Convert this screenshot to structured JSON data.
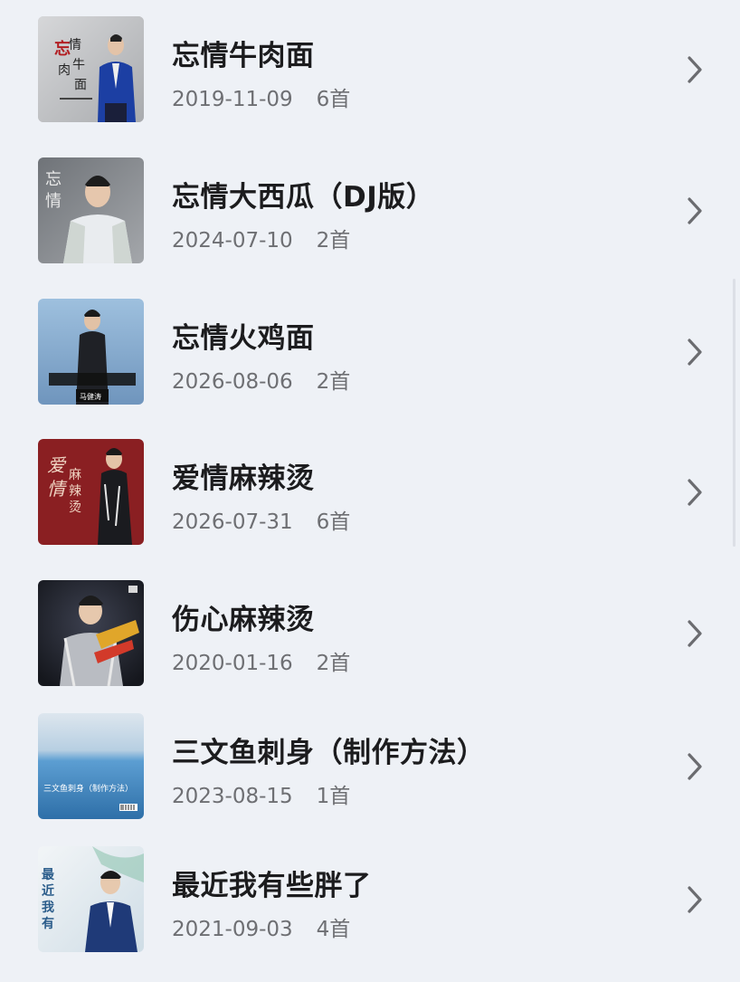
{
  "albums": [
    {
      "title": "忘情牛肉面",
      "date": "2019-11-09",
      "count": "6首",
      "cover_text": "忘情牛肉面",
      "cover_color": "#b9bbbe"
    },
    {
      "title": "忘情大西瓜（DJ版）",
      "date": "2024-07-10",
      "count": "2首",
      "cover_text": "忘情",
      "cover_color": "#7d8186"
    },
    {
      "title": "忘情火鸡面",
      "date": "2026-08-06",
      "count": "2首",
      "cover_text": "马健涛",
      "cover_color": "#8fb0cf"
    },
    {
      "title": "爱情麻辣烫",
      "date": "2026-07-31",
      "count": "6首",
      "cover_text": "爱情麻辣烫",
      "cover_color": "#8a1f22"
    },
    {
      "title": "伤心麻辣烫",
      "date": "2020-01-16",
      "count": "2首",
      "cover_text": "",
      "cover_color": "#2a2d36"
    },
    {
      "title": "三文鱼刺身（制作方法）",
      "date": "2023-08-15",
      "count": "1首",
      "cover_text": "三文鱼刺身（制作方法）",
      "cover_color": "#4d92c9"
    },
    {
      "title": "最近我有些胖了",
      "date": "2021-09-03",
      "count": "4首",
      "cover_text": "最近我有些胖了",
      "cover_color": "#e9eef2"
    }
  ],
  "icons": {
    "chevron": "chevron-right-icon"
  },
  "colors": {
    "background": "#eef1f6",
    "title": "#1c1c1e",
    "meta": "#6e6f73",
    "chevron": "#6b6c70"
  }
}
